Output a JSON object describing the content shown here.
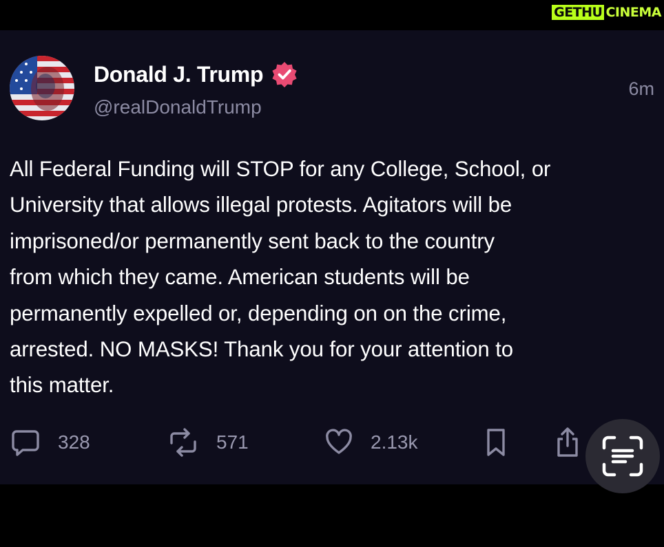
{
  "watermark": {
    "left": "GETHU",
    "right": "CINEMA"
  },
  "post": {
    "author_name": "Donald J. Trump",
    "handle": "@realDonaldTrump",
    "time": "6m",
    "body": "All Federal Funding will STOP for any College, School, or\nUniversity that allows illegal protests. Agitators will be\nimprisoned/or permanently sent back to the country\nfrom which they came. American students will be\npermanently expelled or, depending on on the crime,\narrested. NO MASKS! Thank you for your attention to\nthis matter."
  },
  "actions": {
    "replies": "328",
    "reposts": "571",
    "likes": "2.13k"
  },
  "icons": {
    "avatar": "flag-portrait-avatar",
    "verified": "verified-badge-icon",
    "reply": "speech-bubble-icon",
    "repost": "repost-arrows-icon",
    "like": "heart-icon",
    "bookmark": "bookmark-icon",
    "share": "share-icon",
    "lens": "text-scan-icon"
  },
  "colors": {
    "background": "#000000",
    "card": "#0e0d1c",
    "muted_text": "#8c8ba3",
    "verified": "#e94b73",
    "watermark": "#b9ff1a"
  }
}
